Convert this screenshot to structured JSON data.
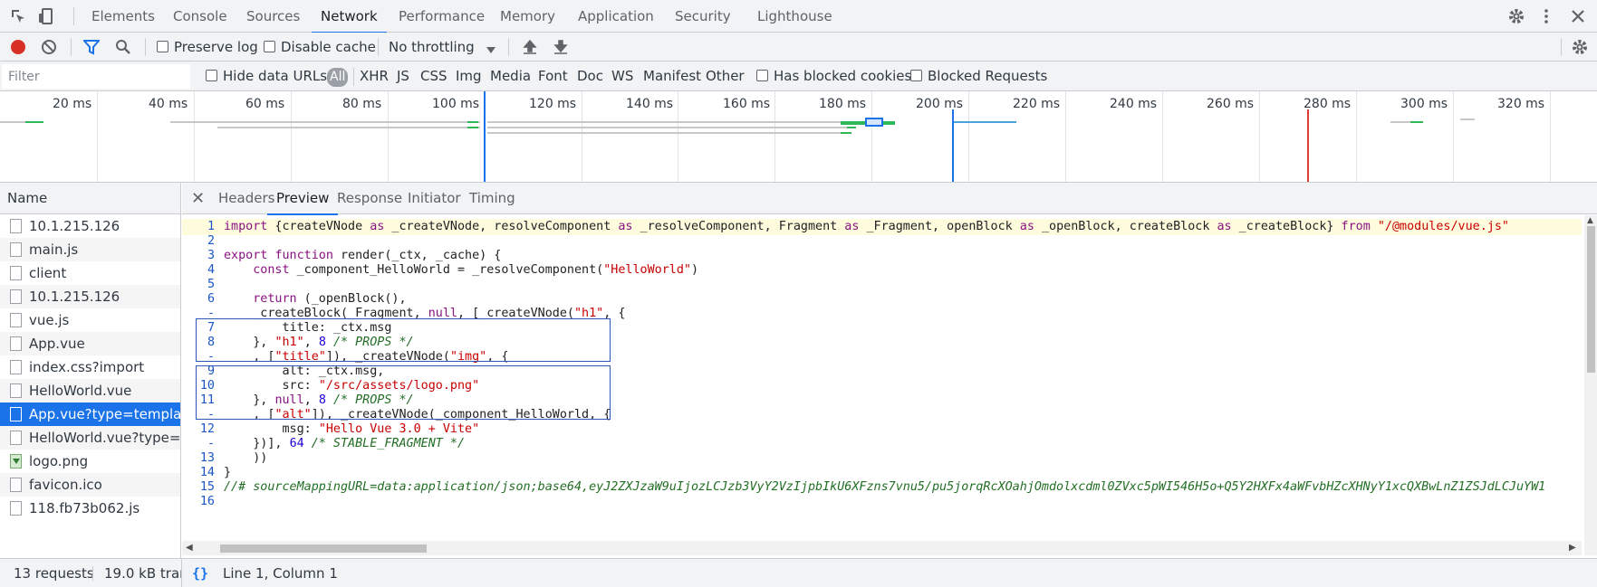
{
  "tabs": [
    {
      "label": "Elements"
    },
    {
      "label": "Console"
    },
    {
      "label": "Sources"
    },
    {
      "label": "Network",
      "active": true
    },
    {
      "label": "Performance"
    },
    {
      "label": "Memory"
    },
    {
      "label": "Application"
    },
    {
      "label": "Security"
    },
    {
      "label": "Lighthouse"
    }
  ],
  "toolbar": {
    "preserve_log": "Preserve log",
    "disable_cache": "Disable cache",
    "throttling": "No throttling",
    "record_color": "#d93025",
    "filter_color": "#1a73e8"
  },
  "filterbar": {
    "filter_placeholder": "Filter",
    "hide_data_urls": "Hide data URLs",
    "types": [
      "All",
      "XHR",
      "JS",
      "CSS",
      "Img",
      "Media",
      "Font",
      "Doc",
      "WS",
      "Manifest",
      "Other"
    ],
    "has_blocked_cookies": "Has blocked cookies",
    "blocked_requests": "Blocked Requests"
  },
  "overview": {
    "ticks": [
      "20 ms",
      "40 ms",
      "60 ms",
      "80 ms",
      "100 ms",
      "120 ms",
      "140 ms",
      "160 ms",
      "180 ms",
      "200 ms",
      "220 ms",
      "240 ms",
      "260 ms",
      "280 ms",
      "300 ms",
      "320 ms"
    ],
    "domcontentloaded_color": "#1a73e8",
    "load_color": "#e53935"
  },
  "requests": {
    "header": "Name",
    "items": [
      {
        "name": "10.1.215.126",
        "type": "doc"
      },
      {
        "name": "main.js",
        "type": "doc"
      },
      {
        "name": "client",
        "type": "doc"
      },
      {
        "name": "10.1.215.126",
        "type": "doc"
      },
      {
        "name": "vue.js",
        "type": "doc"
      },
      {
        "name": "App.vue",
        "type": "doc"
      },
      {
        "name": "index.css?import",
        "type": "doc"
      },
      {
        "name": "HelloWorld.vue",
        "type": "doc"
      },
      {
        "name": "App.vue?type=template",
        "type": "doc",
        "selected": true
      },
      {
        "name": "HelloWorld.vue?type=…",
        "type": "doc"
      },
      {
        "name": "logo.png",
        "type": "img"
      },
      {
        "name": "favicon.ico",
        "type": "doc"
      },
      {
        "name": "118.fb73b062.js",
        "type": "doc"
      }
    ]
  },
  "detail": {
    "tabs": [
      "Headers",
      "Preview",
      "Response",
      "Initiator",
      "Timing"
    ],
    "active_tab": "Preview"
  },
  "code_lines": [
    {
      "ln": "1",
      "text": "import {createVNode as _createVNode, resolveComponent as _resolveComponent, Fragment as _Fragment, openBlock as _openBlock, createBlock as _createBlock} from \"/@modules/vue.js\"",
      "highlight": true
    },
    {
      "ln": "2",
      "text": ""
    },
    {
      "ln": "3",
      "text": "export function render(_ctx, _cache) {"
    },
    {
      "ln": "4",
      "text": "    const _component_HelloWorld = _resolveComponent(\"HelloWorld\")"
    },
    {
      "ln": "5",
      "text": ""
    },
    {
      "ln": "6",
      "text": "    return (_openBlock(),"
    },
    {
      "ln": "-",
      "text": "    _createBlock(_Fragment, null, [_createVNode(\"h1\", {"
    },
    {
      "ln": "7",
      "text": "        title: _ctx.msg"
    },
    {
      "ln": "8",
      "text": "    }, \"h1\", 8 /* PROPS */"
    },
    {
      "ln": "-",
      "text": "    , [\"title\"]), _createVNode(\"img\", {"
    },
    {
      "ln": "9",
      "text": "        alt: _ctx.msg,"
    },
    {
      "ln": "10",
      "text": "        src: \"/src/assets/logo.png\""
    },
    {
      "ln": "11",
      "text": "    }, null, 8 /* PROPS */"
    },
    {
      "ln": "-",
      "text": "    , [\"alt\"]), _createVNode(_component_HelloWorld, {"
    },
    {
      "ln": "12",
      "text": "        msg: \"Hello Vue 3.0 + Vite\""
    },
    {
      "ln": "-",
      "text": "    })], 64 /* STABLE_FRAGMENT */"
    },
    {
      "ln": "13",
      "text": "    ))"
    },
    {
      "ln": "14",
      "text": "}"
    },
    {
      "ln": "15",
      "text": "//# sourceMappingURL=data:application/json;base64,eyJ2ZXJzaW9uIjozLCJzb3VyY2VzIjpbIkU6XFzns7vnu5/pu5jorqRcXOahjOmdolxcdml0ZVxc5pWI546H5o+Q5Y2HXFx4aWFvbHZcXHNyY1xcQXBwLnZ1ZSJdLCJuYW1"
    },
    {
      "ln": "16",
      "text": ""
    }
  ],
  "status": {
    "requests": "13 requests",
    "transferred": "19.0 kB trans",
    "position": "Line 1, Column 1",
    "pretty_print": "{}"
  }
}
